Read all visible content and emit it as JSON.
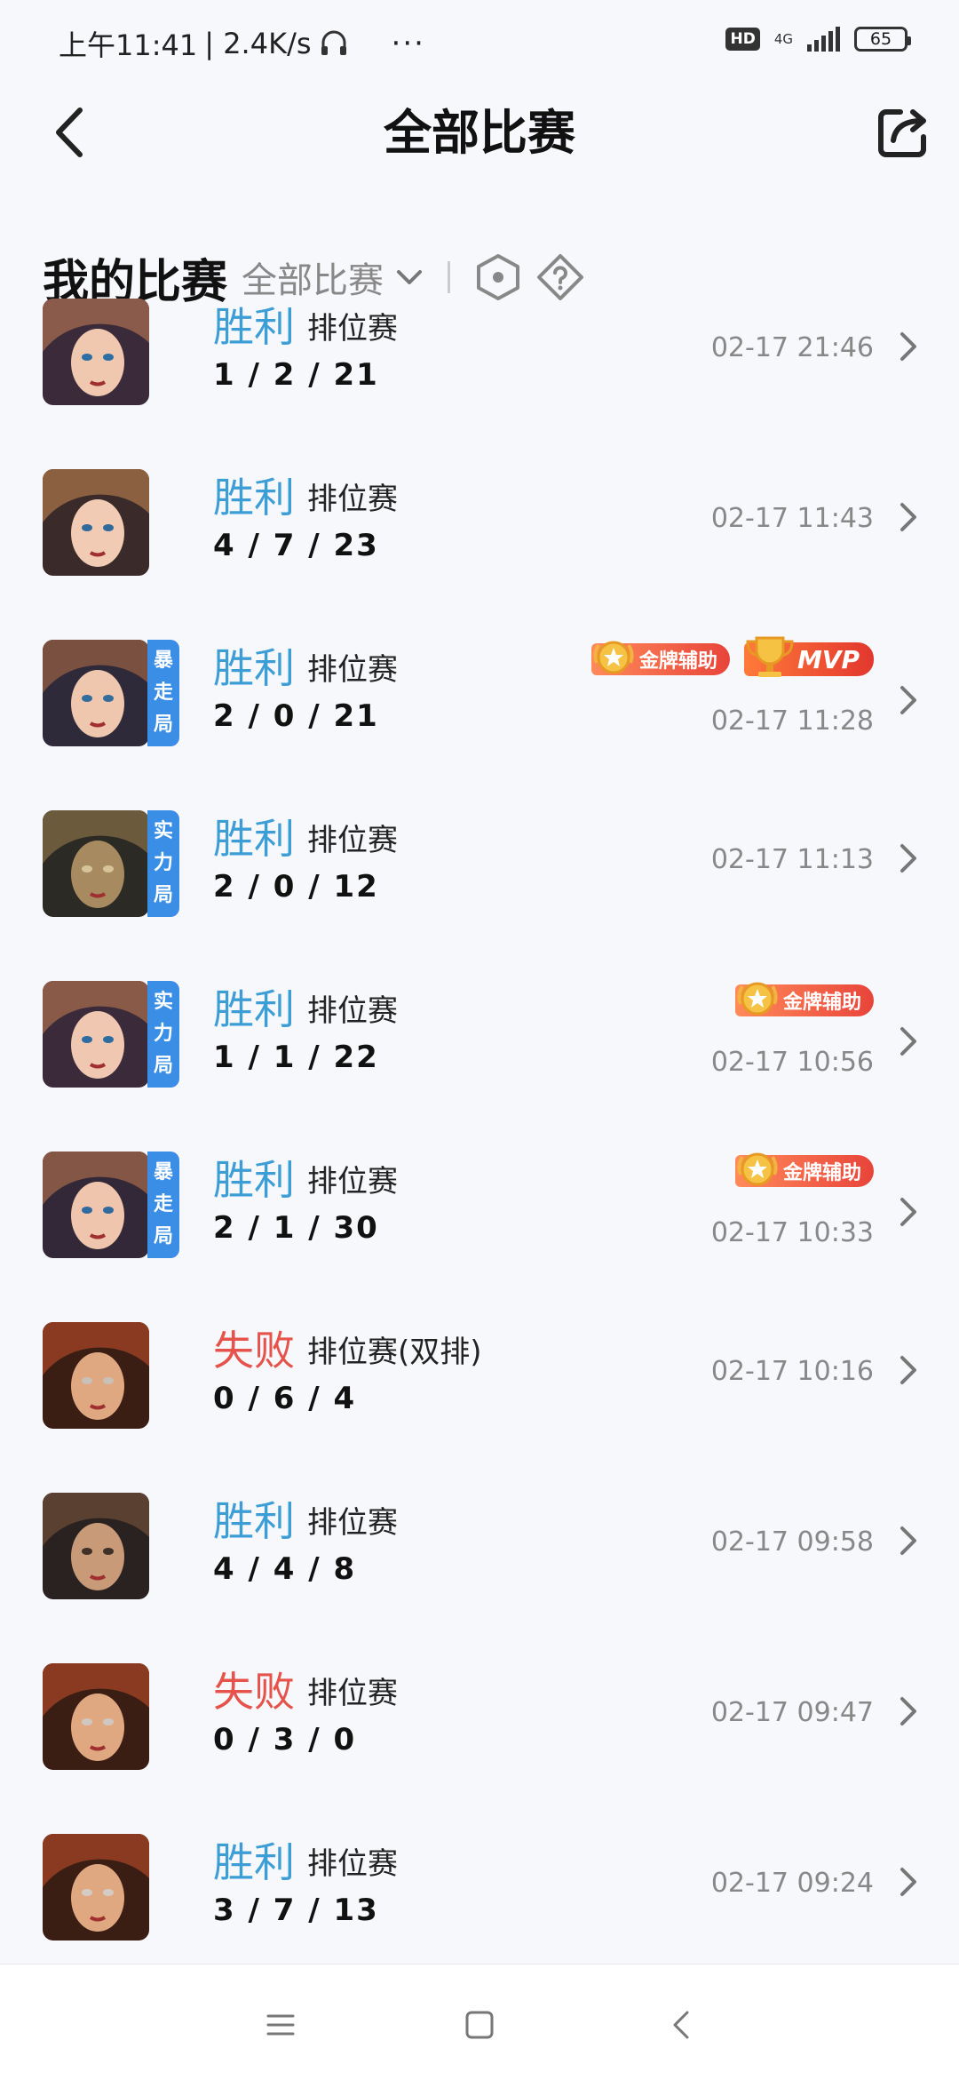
{
  "status_bar": {
    "time": "上午11:41",
    "speed": "| 2.4K/s",
    "dots": "···",
    "hd": "HD",
    "network": "4G",
    "battery": "65"
  },
  "nav": {
    "title": "全部比赛"
  },
  "filter": {
    "heading": "我的比赛",
    "selected": "全部比赛"
  },
  "matches": [
    {
      "result": "胜利",
      "type": "排位赛",
      "kda": "1 / 2 / 21",
      "time": "02-17 21:46",
      "tag": "",
      "gold": "",
      "mvp": ""
    },
    {
      "result": "胜利",
      "type": "排位赛",
      "kda": "4 / 7 / 23",
      "time": "02-17 11:43",
      "tag": "",
      "gold": "",
      "mvp": ""
    },
    {
      "result": "胜利",
      "type": "排位赛",
      "kda": "2 / 0 / 21",
      "time": "02-17 11:28",
      "tag": "暴走局",
      "gold": "金牌辅助",
      "mvp": "MVP"
    },
    {
      "result": "胜利",
      "type": "排位赛",
      "kda": "2 / 0 / 12",
      "time": "02-17 11:13",
      "tag": "实力局",
      "gold": "",
      "mvp": ""
    },
    {
      "result": "胜利",
      "type": "排位赛",
      "kda": "1 / 1 / 22",
      "time": "02-17 10:56",
      "tag": "实力局",
      "gold": "金牌辅助",
      "mvp": ""
    },
    {
      "result": "胜利",
      "type": "排位赛",
      "kda": "2 / 1 / 30",
      "time": "02-17 10:33",
      "tag": "暴走局",
      "gold": "金牌辅助",
      "mvp": ""
    },
    {
      "result": "失败",
      "type": "排位赛(双排)",
      "kda": "0 / 6 / 4",
      "time": "02-17 10:16",
      "tag": "",
      "gold": "",
      "mvp": ""
    },
    {
      "result": "胜利",
      "type": "排位赛",
      "kda": "4 / 4 / 8",
      "time": "02-17 09:58",
      "tag": "",
      "gold": "",
      "mvp": ""
    },
    {
      "result": "失败",
      "type": "排位赛",
      "kda": "0 / 3 / 0",
      "time": "02-17 09:47",
      "tag": "",
      "gold": "",
      "mvp": ""
    },
    {
      "result": "胜利",
      "type": "排位赛",
      "kda": "3 / 7 / 13",
      "time": "02-17 09:24",
      "tag": "",
      "gold": "",
      "mvp": ""
    }
  ],
  "colors": {
    "win": "#3d9ed6",
    "loss": "#e5534b",
    "tag": "#3a8ee6"
  },
  "icons": {
    "back": "chevron-left-icon",
    "share": "share-icon",
    "hexagon": "hexagon-icon",
    "help": "diamond-question-icon",
    "menu": "menu-icon",
    "home": "home-square-icon",
    "nav_back": "nav-back-icon"
  }
}
